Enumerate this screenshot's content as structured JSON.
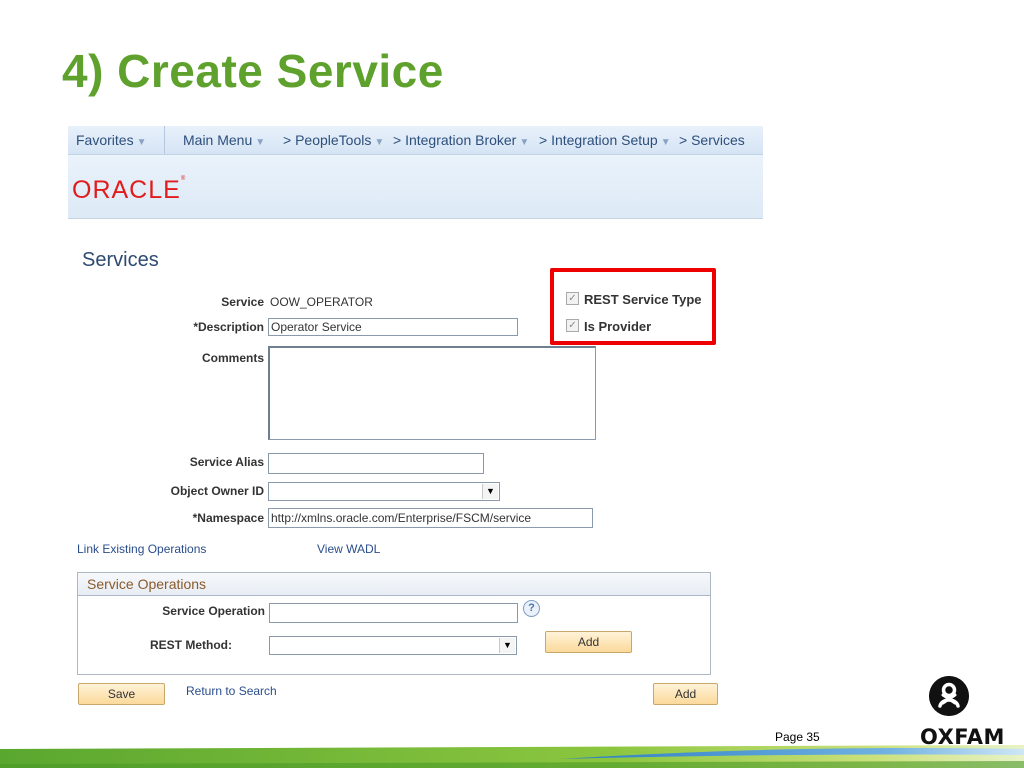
{
  "slide": {
    "title": "4) Create Service",
    "page_number": "Page 35",
    "logo_text": "OXFAM"
  },
  "nav": {
    "favorites": "Favorites",
    "main_menu": "Main Menu",
    "peopletools": "> PeopleTools",
    "integration_broker": "> Integration Broker",
    "integration_setup": "> Integration Setup",
    "services": "> Services"
  },
  "brand": {
    "oracle": "ORACLE"
  },
  "form": {
    "heading": "Services",
    "service_label": "Service",
    "service_value": "OOW_OPERATOR",
    "description_label": "*Description",
    "description_value": "Operator Service",
    "comments_label": "Comments",
    "comments_value": "",
    "alias_label": "Service Alias",
    "alias_value": "",
    "owner_label": "Object Owner ID",
    "owner_value": "",
    "namespace_label": "*Namespace",
    "namespace_value": "http://xmlns.oracle.com/Enterprise/FSCM/service",
    "rest_service_type_label": "REST Service Type",
    "rest_service_type_checked": true,
    "is_provider_label": "Is Provider",
    "is_provider_checked": true
  },
  "links": {
    "link_existing": "Link Existing Operations",
    "view_wadl": "View WADL",
    "return_to_search": "Return to Search"
  },
  "operations": {
    "group_title": "Service Operations",
    "service_operation_label": "Service Operation",
    "service_operation_value": "",
    "rest_method_label": "REST Method:",
    "rest_method_value": "",
    "add_label": "Add"
  },
  "buttons": {
    "save": "Save",
    "add": "Add"
  },
  "colors": {
    "title_green": "#5fa12d",
    "highlight_red": "#ee0000",
    "oracle_red": "#e11c1c",
    "link_blue": "#2a4d8c"
  }
}
